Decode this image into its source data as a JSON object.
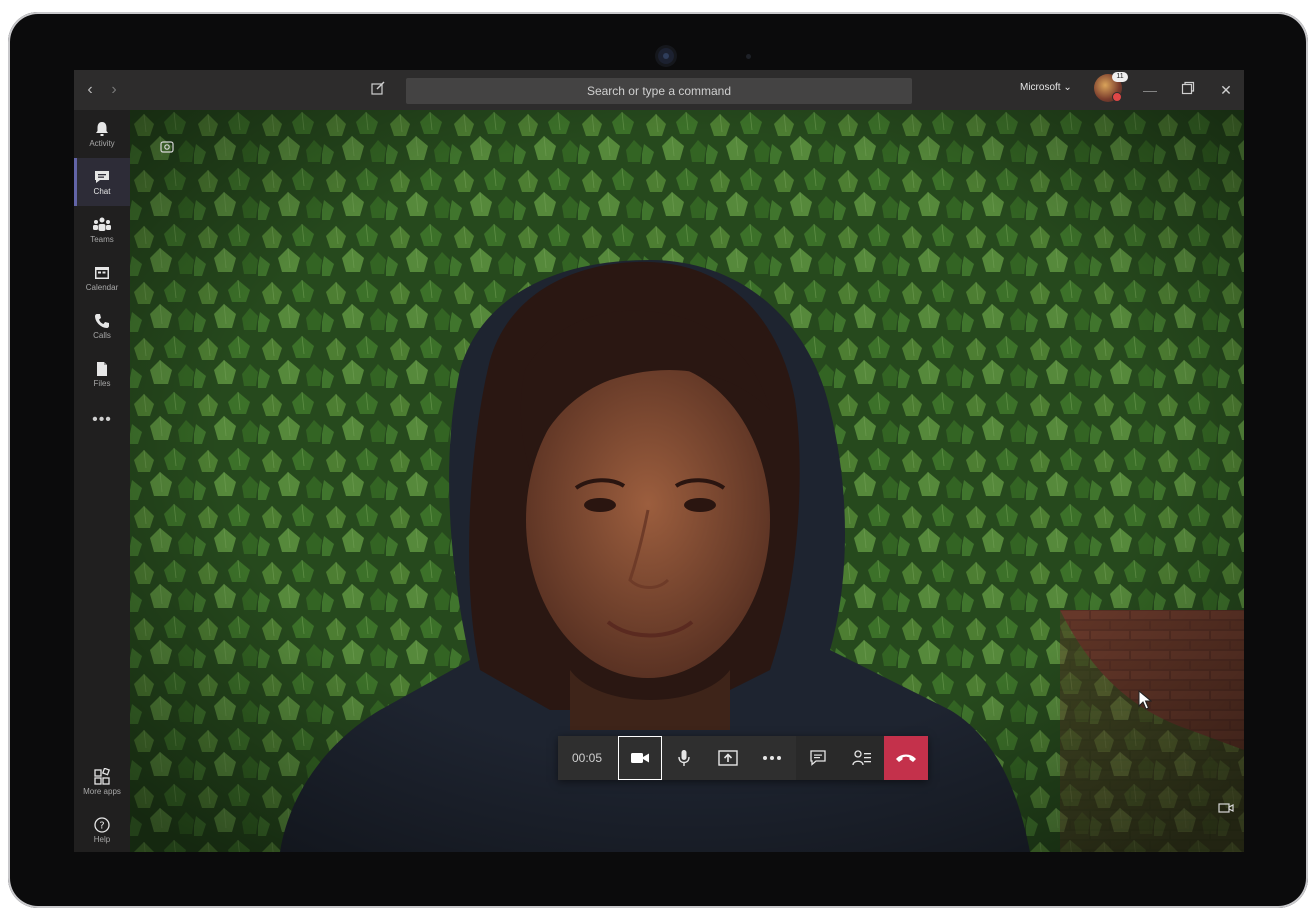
{
  "titlebar": {
    "search_placeholder": "Search or type a command",
    "org_label": "Microsoft",
    "avatar_badge": "11"
  },
  "rail": {
    "items": [
      {
        "label": "Activity",
        "icon": "bell-icon"
      },
      {
        "label": "Chat",
        "icon": "chat-icon",
        "active": true
      },
      {
        "label": "Teams",
        "icon": "teams-icon"
      },
      {
        "label": "Calendar",
        "icon": "calendar-icon"
      },
      {
        "label": "Calls",
        "icon": "phone-icon"
      },
      {
        "label": "Files",
        "icon": "file-icon"
      }
    ],
    "more": "•••",
    "bottom": [
      {
        "label": "More apps",
        "icon": "apps-icon"
      },
      {
        "label": "Help",
        "icon": "help-icon"
      }
    ]
  },
  "call": {
    "timer": "00:05",
    "controls": [
      "camera-icon",
      "microphone-icon",
      "share-screen-icon",
      "more-icon",
      "chat-icon",
      "participants-icon",
      "hang-up-icon"
    ]
  },
  "colors": {
    "accent": "#6264a7",
    "hangup": "#c4314b",
    "titlebar": "#2d2c2c"
  }
}
